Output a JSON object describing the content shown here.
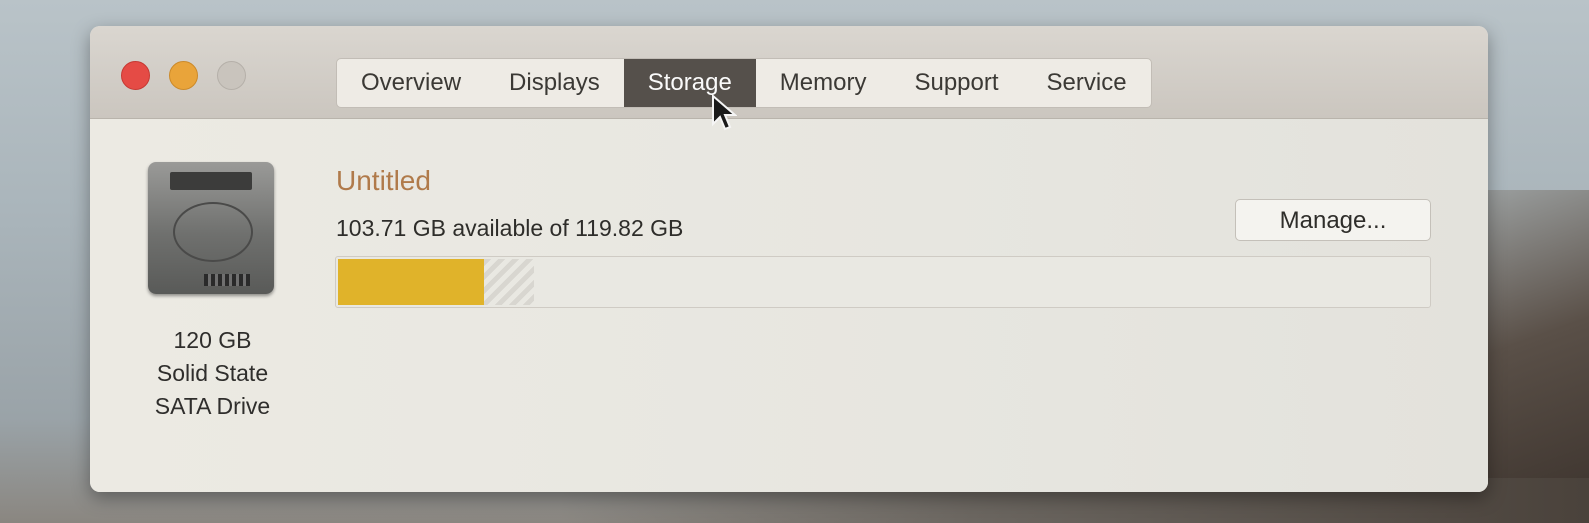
{
  "window": {
    "tabs": [
      {
        "label": "Overview",
        "active": false
      },
      {
        "label": "Displays",
        "active": false
      },
      {
        "label": "Storage",
        "active": true
      },
      {
        "label": "Memory",
        "active": false
      },
      {
        "label": "Support",
        "active": false
      },
      {
        "label": "Service",
        "active": false
      }
    ]
  },
  "drive": {
    "icon": "hard-drive-icon",
    "line1": "120 GB",
    "line2": "Solid State",
    "line3": "SATA Drive"
  },
  "volume": {
    "name": "Untitled",
    "capacity_text": "103.71 GB available of 119.82 GB",
    "used_fraction": 0.134,
    "used_color": "#e0b32a",
    "manage_label": "Manage..."
  },
  "colors": {
    "close": "#e54b45",
    "minimize": "#e9a43a",
    "zoom": "#c9c4bd",
    "active_tab": "#55504b"
  }
}
